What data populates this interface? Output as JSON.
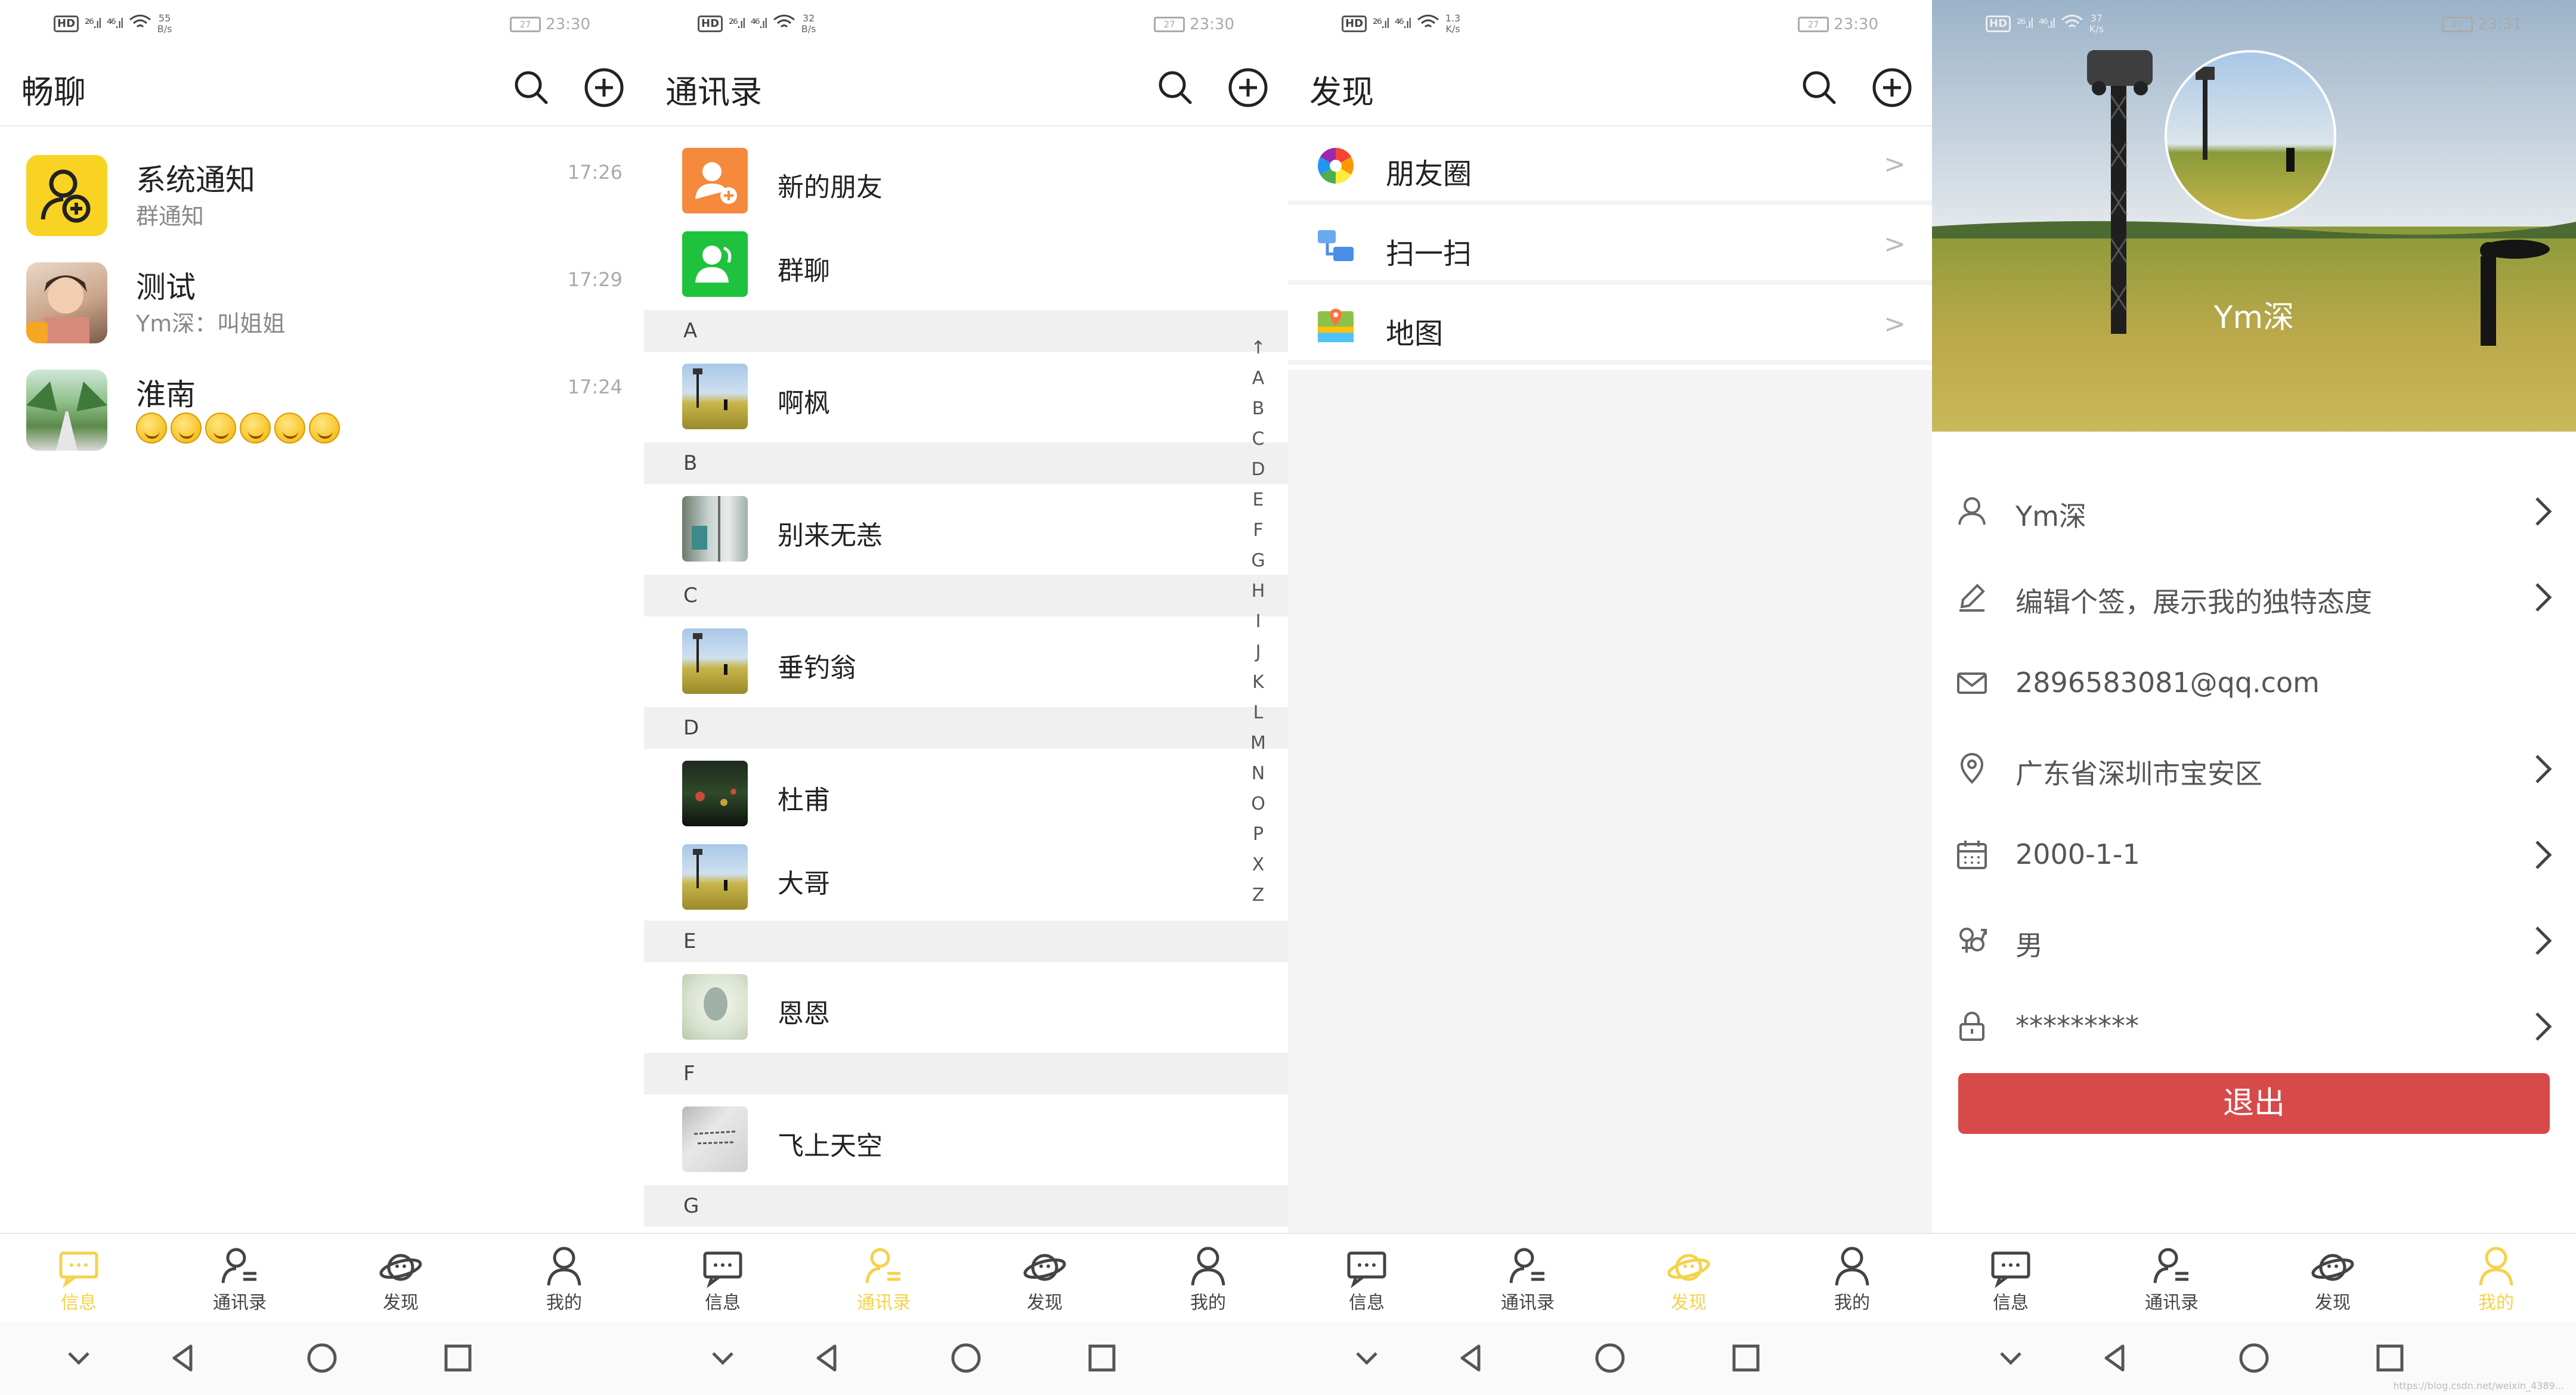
{
  "status_bars": [
    {
      "speed": "55\nB/s",
      "battery": "27",
      "time": "23:30"
    },
    {
      "speed": "32\nB/s",
      "battery": "27",
      "time": "23:30"
    },
    {
      "speed": "1.3\nK/s",
      "battery": "27",
      "time": "23:30"
    },
    {
      "speed": "37\nK/s",
      "battery": "27",
      "time": "23:31"
    }
  ],
  "status_common": {
    "hd": "HD",
    "signal1": "²⁶.ıl",
    "signal2": "⁴⁶.ıl"
  },
  "chats": {
    "title": "畅聊",
    "items": [
      {
        "name": "系统通知",
        "sub": "群通知",
        "time": "17:26"
      },
      {
        "name": "测试",
        "sub": "Ym深：叫姐姐",
        "time": "17:29"
      },
      {
        "name": "淮南",
        "sub": "",
        "time": "17:24"
      }
    ]
  },
  "contacts": {
    "title": "通讯录",
    "top_items": [
      {
        "name": "新的朋友"
      },
      {
        "name": "群聊"
      }
    ],
    "sections": [
      {
        "letter": "A",
        "items": [
          "啊枫"
        ]
      },
      {
        "letter": "B",
        "items": [
          "别来无恙"
        ]
      },
      {
        "letter": "C",
        "items": [
          "垂钓翁"
        ]
      },
      {
        "letter": "D",
        "items": [
          "杜甫",
          "大哥"
        ]
      },
      {
        "letter": "E",
        "items": [
          "恩恩"
        ]
      },
      {
        "letter": "F",
        "items": [
          "飞上天空"
        ]
      },
      {
        "letter": "G",
        "items": []
      }
    ],
    "index": [
      "↑",
      "A",
      "B",
      "C",
      "D",
      "E",
      "F",
      "G",
      "H",
      "I",
      "J",
      "K",
      "L",
      "M",
      "N",
      "O",
      "P",
      "X",
      "Z"
    ]
  },
  "discover": {
    "title": "发现",
    "items": [
      {
        "label": "朋友圈",
        "arrow": ">"
      },
      {
        "label": "扫一扫",
        "arrow": ">"
      },
      {
        "label": "地图",
        "arrow": ">"
      }
    ]
  },
  "profile": {
    "username": "Ym深",
    "rows": [
      {
        "text": "Ym深",
        "icon": "user-icon"
      },
      {
        "text": "编辑个签，展示我的独特态度",
        "icon": "pencil-icon"
      },
      {
        "text": "2896583081@qq.com",
        "icon": "mail-icon"
      },
      {
        "text": "广东省深圳市宝安区",
        "icon": "location-icon"
      },
      {
        "text": "2000-1-1",
        "icon": "calendar-icon"
      },
      {
        "text": "男",
        "icon": "gender-icon"
      },
      {
        "text": "*********",
        "icon": "lock-icon"
      }
    ],
    "logout": "退出",
    "watermark": "https://blog.csdn.net/weixin_4389..."
  },
  "bottom_nav": [
    "信息",
    "通讯录",
    "发现",
    "我的"
  ],
  "colors": {
    "accent": "#f5d24b",
    "logout": "#d8494a",
    "divider": "#ececec",
    "section_bg": "#f0f0f0"
  }
}
